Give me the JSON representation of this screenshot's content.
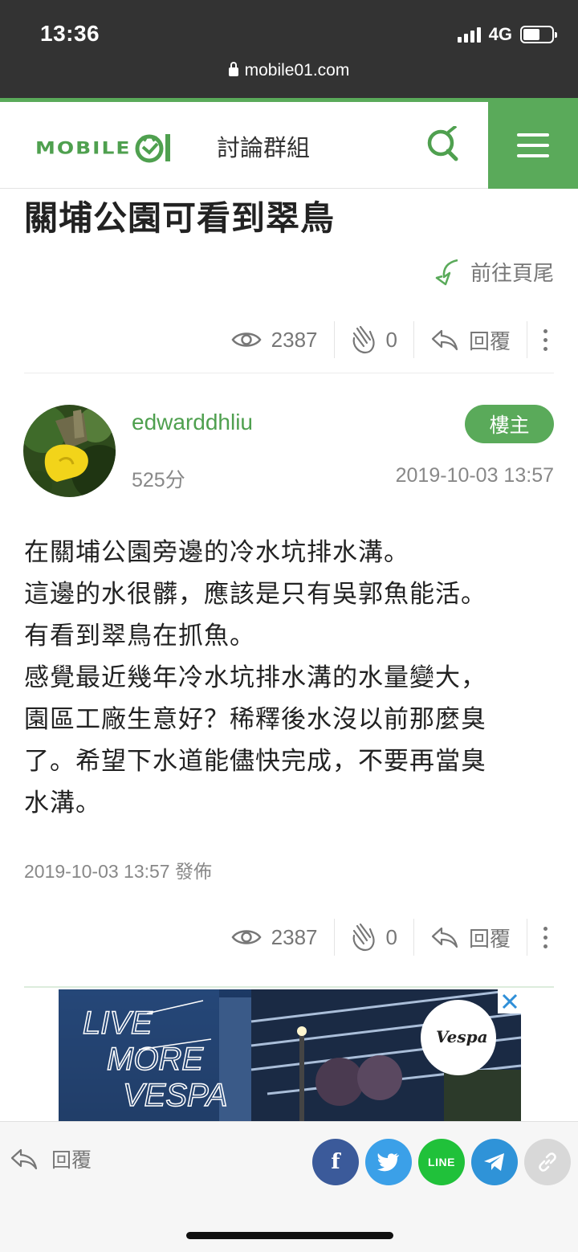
{
  "status_bar": {
    "time": "13:36",
    "network": "4G",
    "url": "mobile01.com"
  },
  "header": {
    "logo_text": "MOBILE",
    "title": "討論群組"
  },
  "post": {
    "title": "關埔公園可看到翠鳥",
    "goto_bottom": "前往頁尾",
    "author": "edwarddhliu",
    "badge": "樓主",
    "score": "525分",
    "time": "2019-10-03 13:57",
    "body_lines": [
      "在關埔公園旁邊的冷水坑排水溝。",
      "這邊的水很髒，應該是只有吳郭魚能活。",
      "有看到翠鳥在抓魚。",
      "感覺最近幾年冷水坑排水溝的水量變大，",
      "園區工廠生意好？稀釋後水沒以前那麼臭",
      "了。希望下水道能儘快完成，不要再當臭",
      "水溝。"
    ],
    "published": "2019-10-03 13:57 發佈"
  },
  "stats_top": {
    "views": "2387",
    "likes": "0",
    "reply": "回覆"
  },
  "stats_bottom": {
    "views": "2387",
    "likes": "0",
    "reply": "回覆"
  },
  "ad": {
    "text": [
      "LIVE",
      "MORE",
      "VESPA"
    ],
    "brand": "Vespa"
  },
  "bottom_bar": {
    "reply": "回覆",
    "line_label": "LINE",
    "fb_label": "f"
  },
  "colors": {
    "brand_green": "#5aaa5a",
    "status_bar": "#333333",
    "facebook": "#3b5a9a",
    "twitter": "#3ba0e8",
    "line": "#20c13a",
    "telegram": "#2f93d8"
  }
}
